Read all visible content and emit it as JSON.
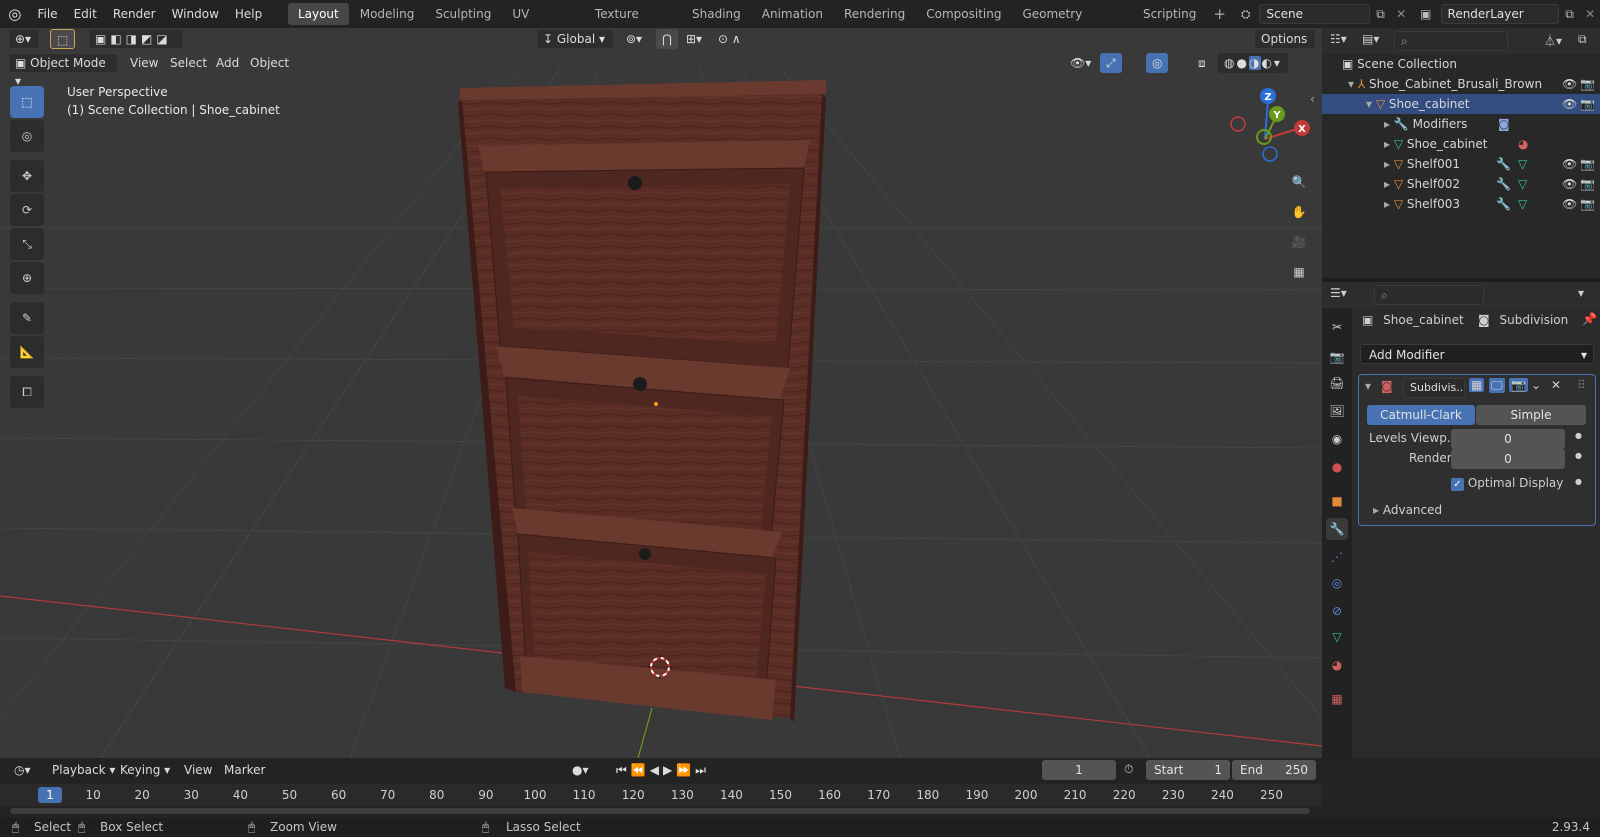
{
  "app": {
    "version": "2.93.4"
  },
  "menu": [
    "File",
    "Edit",
    "Render",
    "Window",
    "Help"
  ],
  "workspaces": [
    "Layout",
    "Modeling",
    "Sculpting",
    "UV Editing",
    "Texture Paint",
    "Shading",
    "Animation",
    "Rendering",
    "Compositing",
    "Geometry Nodes",
    "Scripting"
  ],
  "active_workspace": "Layout",
  "scene": {
    "name": "Scene",
    "view_layer": "RenderLayer"
  },
  "viewport": {
    "mode": "Object Mode",
    "menus": [
      "View",
      "Select",
      "Add",
      "Object"
    ],
    "orientation": "Global",
    "options_label": "Options",
    "overlay_line1": "User Perspective",
    "overlay_line2": "(1) Scene Collection | Shoe_cabinet",
    "gizmo_axes": [
      "Z",
      "Y",
      "X"
    ],
    "tools": [
      "select-box",
      "cursor",
      "move",
      "rotate",
      "scale",
      "transform",
      "annotate",
      "measure",
      "add-cube"
    ]
  },
  "outliner": {
    "root": "Scene Collection",
    "rows": [
      {
        "label": "Shoe_Cabinet_Brusali_Brown",
        "icon": "armature-icon"
      },
      {
        "label": "Shoe_cabinet",
        "icon": "mesh-object-icon"
      },
      {
        "label": "Modifiers",
        "icon": "wrench-icon"
      },
      {
        "label": "Shoe_cabinet",
        "icon": "mesh-data-icon"
      },
      {
        "label": "Shelf001",
        "icon": "mesh-object-icon"
      },
      {
        "label": "Shelf002",
        "icon": "mesh-object-icon"
      },
      {
        "label": "Shelf003",
        "icon": "mesh-object-icon"
      }
    ]
  },
  "properties": {
    "object": "Shoe_cabinet",
    "modifier_type": "Subdivision",
    "add_modifier": "Add Modifier",
    "modifier_name": "Subdivis...",
    "algo_catmull": "Catmull-Clark",
    "algo_simple": "Simple",
    "levels_label": "Levels Viewp...",
    "levels_value": "0",
    "render_label": "Render",
    "render_value": "0",
    "optimal_display": "Optimal Display",
    "advanced": "Advanced"
  },
  "timeline": {
    "menus": [
      "Playback",
      "Keying",
      "View",
      "Marker"
    ],
    "current_frame": "1",
    "start_label": "Start",
    "start": "1",
    "end_label": "End",
    "end": "250",
    "ticks": [
      "1",
      "10",
      "20",
      "30",
      "40",
      "50",
      "60",
      "70",
      "80",
      "90",
      "100",
      "110",
      "120",
      "130",
      "140",
      "150",
      "160",
      "170",
      "180",
      "190",
      "200",
      "210",
      "220",
      "230",
      "240",
      "250"
    ]
  },
  "statusbar": {
    "select": "Select",
    "box_select": "Box Select",
    "zoom_view": "Zoom View",
    "lasso_select": "Lasso Select"
  },
  "colors": {
    "accent": "#4772b3",
    "wood": "#5b2e25",
    "x_axis": "#c0392b",
    "y_axis": "#6a9a1f"
  }
}
